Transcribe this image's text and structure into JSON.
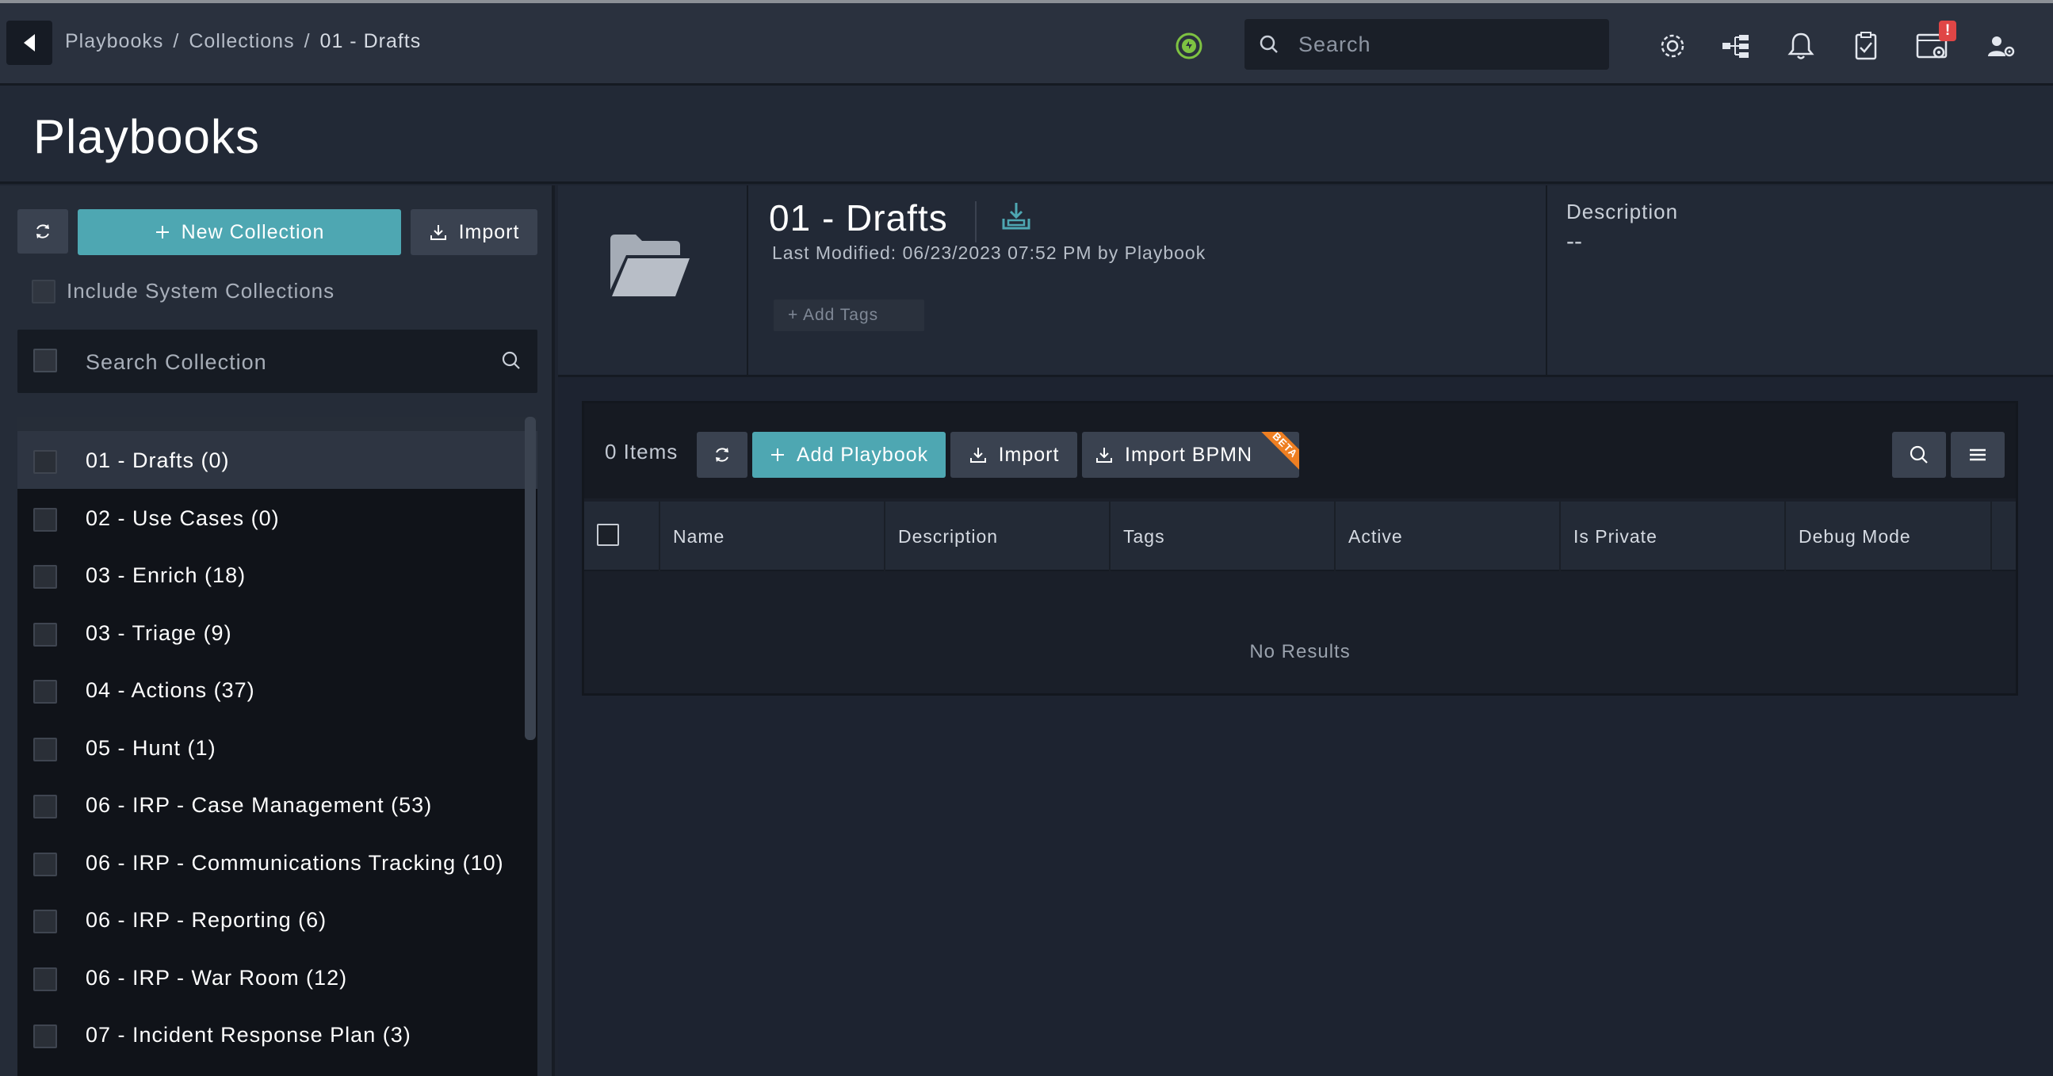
{
  "breadcrumb": {
    "items": [
      "Playbooks",
      "Collections"
    ],
    "separator": "/",
    "current": "01 - Drafts"
  },
  "topbar": {
    "search_placeholder": "Search",
    "alert_badge": "!",
    "icons": [
      "back-icon",
      "status-power-icon",
      "search-icon",
      "settings-gear-icon",
      "hierarchy-icon",
      "bell-icon",
      "clipboard-check-icon",
      "system-settings-icon",
      "user-settings-icon"
    ]
  },
  "page": {
    "title": "Playbooks"
  },
  "left_panel": {
    "new_collection_label": "New Collection",
    "import_label": "Import",
    "include_system_label": "Include System Collections",
    "search_placeholder": "Search Collection",
    "collections": [
      "01 - Drafts (0)",
      "02 - Use Cases (0)",
      "03 - Enrich (18)",
      "03 - Triage (9)",
      "04 - Actions (37)",
      "05 - Hunt (1)",
      "06 - IRP - Case Management (53)",
      "06 - IRP - Communications Tracking (10)",
      "06 - IRP - Reporting (6)",
      "06 - IRP - War Room (12)",
      "07 - Incident Response Plan (3)"
    ]
  },
  "collection_detail": {
    "title": "01 - Drafts",
    "last_modified": "Last Modified: 06/23/2023 07:52 PM by Playbook",
    "add_tags_label": "+ Add Tags",
    "description_label": "Description",
    "description_value": "--"
  },
  "grid": {
    "items_count": "0 Items",
    "add_playbook_label": "Add Playbook",
    "import_label": "Import",
    "import_bpmn_label": "Import BPMN",
    "beta_label": "BETA",
    "columns": [
      "Name",
      "Description",
      "Tags",
      "Active",
      "Is Private",
      "Debug Mode"
    ],
    "empty_text": "No Results"
  },
  "colors": {
    "accent_teal": "#4ea7b2",
    "beta_orange": "#ee7f22",
    "alert_red": "#e04646",
    "status_green": "#7ec242"
  }
}
